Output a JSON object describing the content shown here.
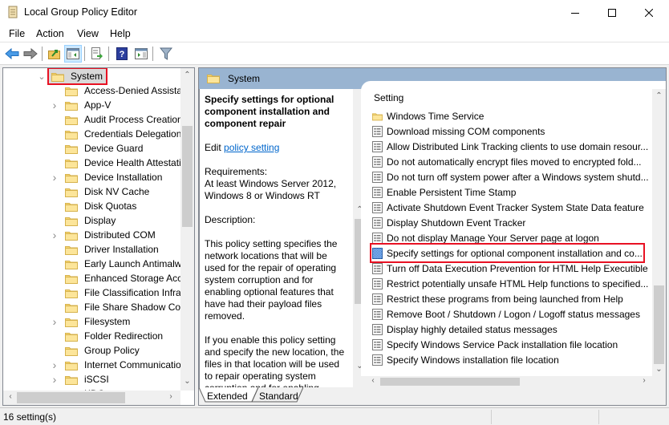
{
  "window": {
    "title": "Local Group Policy Editor",
    "controls": {
      "minimize": "minimize",
      "maximize": "maximize",
      "close": "close"
    }
  },
  "menu": [
    "File",
    "Action",
    "View",
    "Help"
  ],
  "toolbar": [
    {
      "name": "back-icon",
      "tooltip": "Back"
    },
    {
      "name": "forward-icon",
      "tooltip": "Forward"
    },
    {
      "name": "up-folder-icon",
      "tooltip": "Up one level"
    },
    {
      "name": "show-hide-console-tree-icon",
      "tooltip": "Show/Hide Console Tree",
      "active": true
    },
    {
      "name": "export-list-icon",
      "tooltip": "Export List"
    },
    {
      "name": "help-icon",
      "tooltip": "Help"
    },
    {
      "name": "show-hide-action-pane-icon",
      "tooltip": "Show/Hide Action Pane"
    },
    {
      "name": "filter-icon",
      "tooltip": "Filter Options"
    }
  ],
  "tree": {
    "selected": "System",
    "items": [
      {
        "label": "Access-Denied Assistar",
        "expandable": false
      },
      {
        "label": "App-V",
        "expandable": true
      },
      {
        "label": "Audit Process Creation",
        "expandable": false
      },
      {
        "label": "Credentials Delegation",
        "expandable": false
      },
      {
        "label": "Device Guard",
        "expandable": false
      },
      {
        "label": "Device Health Attestati",
        "expandable": false
      },
      {
        "label": "Device Installation",
        "expandable": true
      },
      {
        "label": "Disk NV Cache",
        "expandable": false
      },
      {
        "label": "Disk Quotas",
        "expandable": false
      },
      {
        "label": "Display",
        "expandable": false
      },
      {
        "label": "Distributed COM",
        "expandable": true
      },
      {
        "label": "Driver Installation",
        "expandable": false
      },
      {
        "label": "Early Launch Antimalw",
        "expandable": false
      },
      {
        "label": "Enhanced Storage Acce",
        "expandable": false
      },
      {
        "label": "File Classification Infras",
        "expandable": false
      },
      {
        "label": "File Share Shadow Cop",
        "expandable": false
      },
      {
        "label": "Filesystem",
        "expandable": true
      },
      {
        "label": "Folder Redirection",
        "expandable": false
      },
      {
        "label": "Group Policy",
        "expandable": false
      },
      {
        "label": "Internet Communicatio",
        "expandable": true
      },
      {
        "label": "iSCSI",
        "expandable": true
      },
      {
        "label": "KDC",
        "expandable": false
      }
    ]
  },
  "right": {
    "header": "System",
    "description": {
      "title": "Specify settings for optional component installation and component repair",
      "edit_prefix": "Edit ",
      "edit_link": "policy setting",
      "requirements_label": "Requirements:",
      "requirements": "At least Windows Server 2012, Windows 8 or Windows RT",
      "description_label": "Description:",
      "description_p1": "This policy setting specifies the network locations that will be used for the repair of operating system corruption and for enabling optional features that have had their payload files removed.",
      "description_p2": "If you enable this policy setting and specify the new location, the files in that location will be used to repair operating system corruption and for enabling"
    },
    "list": {
      "column": "Setting",
      "rows": [
        {
          "label": "Windows Time Service",
          "type": "folder"
        },
        {
          "label": "Download missing COM components",
          "type": "policy"
        },
        {
          "label": "Allow Distributed Link Tracking clients to use domain resour...",
          "type": "policy"
        },
        {
          "label": "Do not automatically encrypt files moved to encrypted fold...",
          "type": "policy"
        },
        {
          "label": "Do not turn off system power after a Windows system shutd...",
          "type": "policy"
        },
        {
          "label": "Enable Persistent Time Stamp",
          "type": "policy"
        },
        {
          "label": "Activate Shutdown Event Tracker System State Data feature",
          "type": "policy"
        },
        {
          "label": "Display Shutdown Event Tracker",
          "type": "policy"
        },
        {
          "label": "Do not display Manage Your Server page at logon",
          "type": "policy"
        },
        {
          "label": "Specify settings for optional component installation and co...",
          "type": "policy-selected",
          "selected": true
        },
        {
          "label": "Turn off Data Execution Prevention for HTML Help Executible",
          "type": "policy"
        },
        {
          "label": "Restrict potentially unsafe HTML Help functions to specified...",
          "type": "policy"
        },
        {
          "label": "Restrict these programs from being launched from Help",
          "type": "policy"
        },
        {
          "label": "Remove Boot / Shutdown / Logon / Logoff status messages",
          "type": "policy"
        },
        {
          "label": "Display highly detailed status messages",
          "type": "policy"
        },
        {
          "label": "Specify Windows Service Pack installation file location",
          "type": "policy"
        },
        {
          "label": "Specify Windows installation file location",
          "type": "policy"
        }
      ]
    },
    "tabs": [
      {
        "label": "Extended",
        "active": true
      },
      {
        "label": "Standard",
        "active": false
      }
    ]
  },
  "status": {
    "text": "16 setting(s)"
  },
  "colors": {
    "highlight_box": "#e81123",
    "header_band": "#99b4d1",
    "link": "#0066cc",
    "selection": "#cce8ff"
  }
}
